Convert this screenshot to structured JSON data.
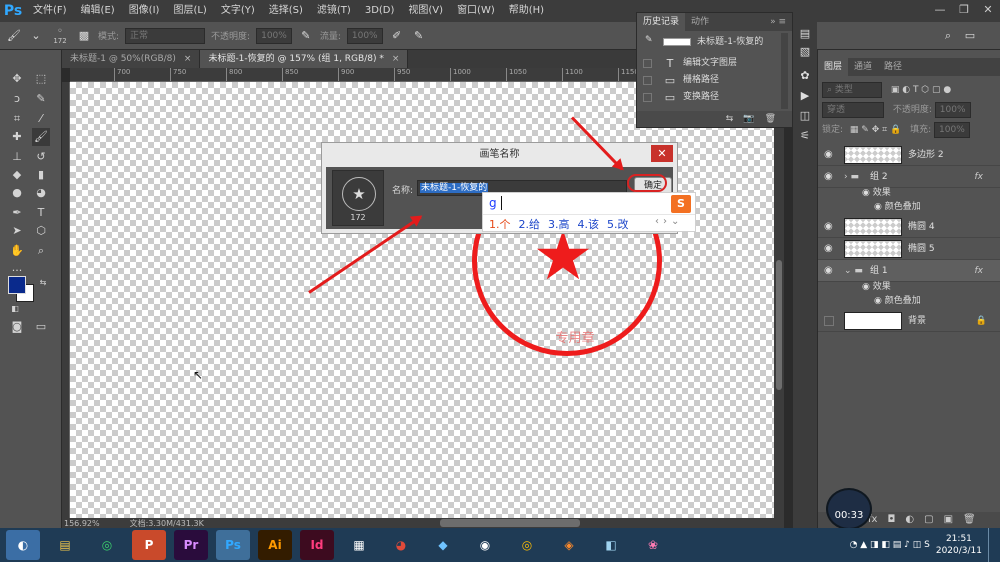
{
  "app": {
    "logo": "Ps"
  },
  "menu": [
    "文件(F)",
    "编辑(E)",
    "图像(I)",
    "图层(L)",
    "文字(Y)",
    "选择(S)",
    "滤镜(T)",
    "3D(D)",
    "视图(V)",
    "窗口(W)",
    "帮助(H)"
  ],
  "window_controls": [
    "—",
    "❐",
    "✕"
  ],
  "options_bar": {
    "brush_size": "172",
    "mode_label": "模式:",
    "mode_value": "正常",
    "opacity_label": "不透明度:",
    "opacity_value": "100%",
    "flow_label": "流量:",
    "flow_value": "100%"
  },
  "doc_tabs": [
    {
      "label": "未标题-1 @ 50%(RGB/8)",
      "close": "×"
    },
    {
      "label": "未标题-1-恢复的 @ 157% (组 1, RGB/8) *",
      "close": "×"
    }
  ],
  "ruler": {
    "h_ticks": [
      "700",
      "750",
      "800",
      "850",
      "900",
      "950",
      "1000",
      "1050",
      "1100",
      "1150",
      "1200",
      "1250",
      "1300",
      "1350"
    ]
  },
  "status": {
    "zoom": "156.92%",
    "doc": "文档:3.30M/431.3K"
  },
  "stamp": {
    "text": "专用章"
  },
  "dialog": {
    "title": "画笔名称",
    "close": "✕",
    "name_label": "名称:",
    "name_value": "未标题-1-恢复的",
    "ok_label": "确定",
    "brush_size": "172"
  },
  "ime": {
    "composition": "g",
    "logo": "S",
    "candidates": [
      "1.个",
      "2.给",
      "3.高",
      "4.该",
      "5.改"
    ],
    "nav": [
      "‹",
      "›",
      "⌄"
    ]
  },
  "history": {
    "tabs": [
      "历史记录",
      "动作"
    ],
    "snapshot_label": "未标题-1-恢复的",
    "items": [
      {
        "icon": "T",
        "label": "编辑文字图层"
      },
      {
        "icon": "▭",
        "label": "栅格路径"
      },
      {
        "icon": "▭",
        "label": "变换路径"
      }
    ],
    "footer": [
      "⇆",
      "📷",
      "🗑"
    ]
  },
  "layers": {
    "tabs": [
      "图层",
      "通道",
      "路径"
    ],
    "filter_kind": "类型",
    "blend_mode": "穿透",
    "opacity_label": "不透明度:",
    "opacity_value": "100%",
    "lock_label": "锁定:",
    "fill_label": "填充:",
    "fill_value": "100%",
    "items": [
      {
        "name": "多边形 2",
        "fx": ""
      },
      {
        "name": "组 2",
        "fx": "fx"
      },
      {
        "name": "椭圆 4",
        "fx": ""
      },
      {
        "name": "椭圆 5",
        "fx": ""
      },
      {
        "name": "组 1",
        "fx": "fx"
      },
      {
        "name": "背景",
        "fx": ""
      }
    ],
    "effects_label": "效果",
    "effect_name": "颜色叠加",
    "footer": [
      "fx",
      "◘",
      "◐",
      "▢",
      "▣",
      "🗑"
    ]
  },
  "timer": "00:33",
  "taskbar": {
    "apps": [
      "◐",
      "▤",
      "◎",
      "P",
      "Pr",
      "Ps",
      "Ai",
      "Id",
      "▦",
      "◕",
      "◆",
      "◉",
      "◎",
      "◈",
      "◧",
      "❀"
    ],
    "clock_time": "21:51",
    "clock_date": "2020/3/11"
  },
  "colors": {
    "accent": "#31a8ff",
    "stamp_red": "#ee1c1c",
    "dialog_close": "#c8312b"
  }
}
